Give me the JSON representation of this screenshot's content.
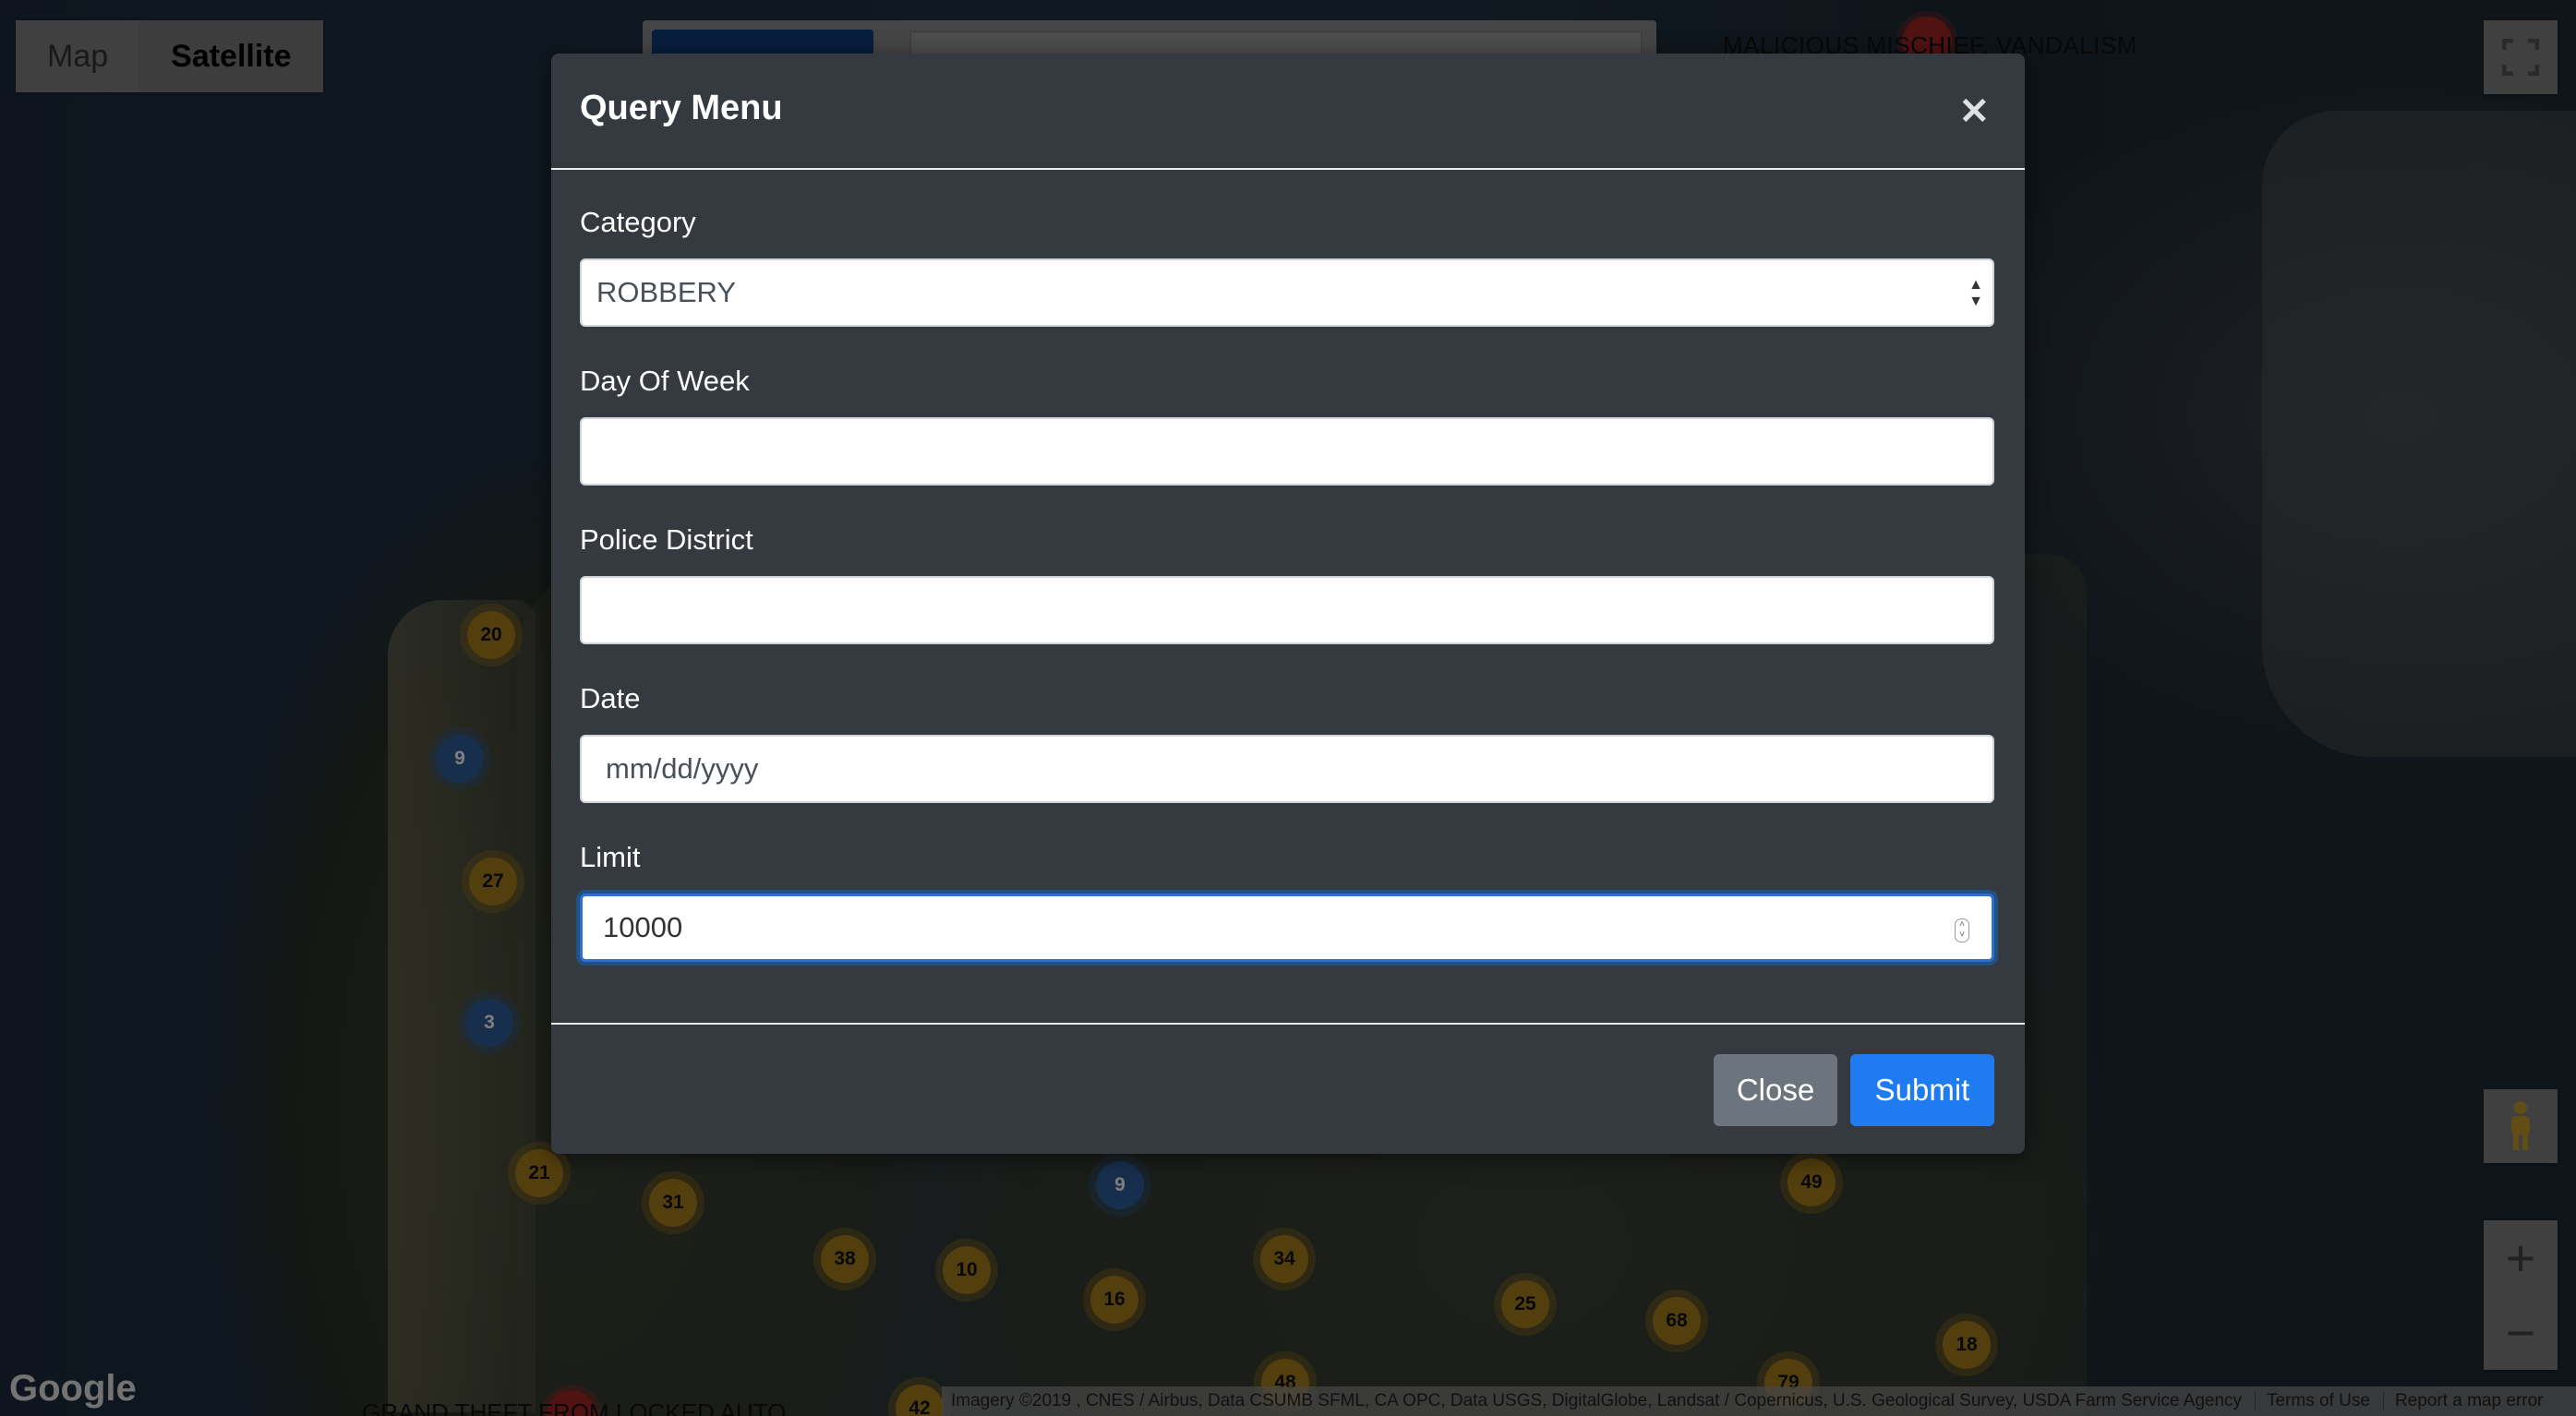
{
  "map": {
    "type_controls": {
      "map_label": "Map",
      "satellite_label": "Satellite",
      "active": "Satellite"
    },
    "top_label": "MALICIOUS MISCHIEF, VANDALISM",
    "bottom_label": "GRAND THEFT FROM LOCKED AUTO",
    "google_logo": "Google",
    "attribution": "Imagery ©2019 , CNES / Airbus, Data CSUMB SFML, CA OPC, Data USGS, DigitalGlobe, Landsat / Copernicus, U.S. Geological Survey, USDA Farm Service Agency",
    "terms": "Terms of Use",
    "report": "Report a map error",
    "icons": {
      "fullscreen": "fullscreen-icon",
      "pegman": "pegman-icon",
      "zoom_in": "plus-icon",
      "zoom_out": "minus-icon"
    },
    "clusters": [
      "20",
      "9",
      "27",
      "3",
      "21",
      "31",
      "38",
      "10",
      "16",
      "34",
      "9",
      "25",
      "68",
      "49",
      "18",
      "79",
      "48",
      "42"
    ]
  },
  "modal": {
    "title": "Query Menu",
    "close_icon": "close-icon",
    "fields": {
      "category": {
        "label": "Category",
        "value": "ROBBERY"
      },
      "day_of_week": {
        "label": "Day Of Week",
        "value": ""
      },
      "police_district": {
        "label": "Police District",
        "value": ""
      },
      "date": {
        "label": "Date",
        "placeholder": "mm/dd/yyyy"
      },
      "limit": {
        "label": "Limit",
        "value": "10000"
      }
    },
    "buttons": {
      "close": "Close",
      "submit": "Submit"
    }
  },
  "colors": {
    "modal_bg": "#343a40",
    "primary": "#1e7cf0",
    "secondary": "#6c757d",
    "cluster": "#a67c1a",
    "cluster_blue": "#2f5f9a"
  }
}
